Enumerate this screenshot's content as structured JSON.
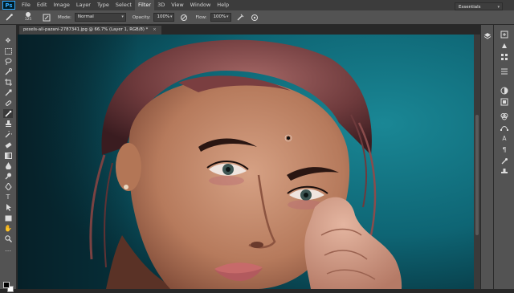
{
  "app": {
    "logo_text": "Ps"
  },
  "menu": [
    {
      "label": "File"
    },
    {
      "label": "Edit"
    },
    {
      "label": "Image"
    },
    {
      "label": "Layer"
    },
    {
      "label": "Type"
    },
    {
      "label": "Select"
    },
    {
      "label": "Filter"
    },
    {
      "label": "3D"
    },
    {
      "label": "View"
    },
    {
      "label": "Window"
    },
    {
      "label": "Help"
    }
  ],
  "options": {
    "brush_size": "125",
    "mode_label": "Mode:",
    "mode_value": "Normal",
    "opacity_label": "Opacity:",
    "opacity_value": "100%",
    "flow_label": "Flow:",
    "flow_value": "100%",
    "workspace": "Essentials"
  },
  "document": {
    "tab_title": "pexels-ali-pazani-2787341.jpg @ 66.7% (Layer 1, RGB/8) *",
    "close_glyph": "×"
  },
  "colors": {
    "canvas_bg": "#0d5a68",
    "panel_bg": "#535353",
    "app_bg": "#282828"
  }
}
